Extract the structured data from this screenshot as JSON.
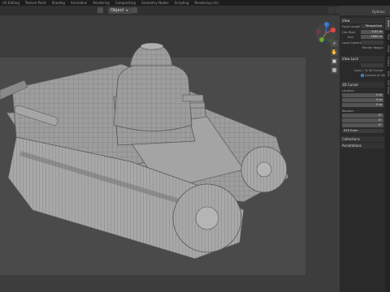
{
  "top_menu": {
    "tabs": [
      "UV Editing",
      "Texture Paint",
      "Shading",
      "Animation",
      "Rendering",
      "Compositing",
      "Geometry Nodes",
      "Scripting",
      "Rendering (ch)"
    ]
  },
  "viewport_header": {
    "mode_label": "Object"
  },
  "options_label": "Options",
  "nav_icons": [
    "zoom-icon",
    "hand-icon",
    "camera-icon",
    "grid-icon"
  ],
  "npanel": {
    "view_header": "View",
    "focal_label": "Focal Length",
    "focal_value": "Perspective",
    "clip_start_label": "Clip Start",
    "clip_start_value": "0.01 m",
    "clip_end_label": "End",
    "clip_end_value": "1000 m",
    "local_camera_label": "Local Camera",
    "render_region_label": "Render Region",
    "view_lock_header": "View Lock",
    "lock_label": "Lock",
    "lock_to_3d_cursor": "To 3D Cursor",
    "lock_camera_to_view": "Camera to View",
    "cursor_header": "3D Cursor",
    "location_label": "Location",
    "loc_x": "0 m",
    "loc_y": "0 m",
    "loc_z": "0 m",
    "rotation_label": "Rotation",
    "rot_x": "0°",
    "rot_y": "0°",
    "rot_z": "0°",
    "rotation_mode": "XYZ Euler",
    "collections_header": "Collections",
    "annotations_header": "Annotations"
  },
  "sidebar_tabs": [
    "Item",
    "Tool",
    "View",
    "Create",
    "Edit",
    "Edit Mode"
  ]
}
